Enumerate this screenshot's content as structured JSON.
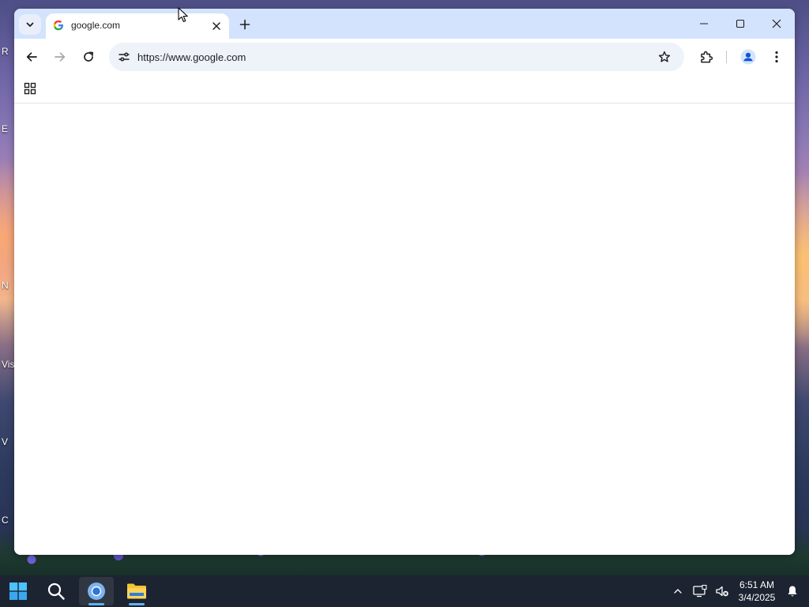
{
  "desktop": {
    "icon_labels": [
      "R",
      "E",
      "N",
      "Vis",
      "V",
      "C"
    ]
  },
  "browser": {
    "tab": {
      "title": "google.com",
      "favicon": "google-g-icon"
    },
    "address_bar": {
      "url": "https://www.google.com"
    },
    "icons": {
      "tab_search": "chevron-down-icon",
      "tab_close": "close-icon",
      "new_tab": "plus-icon",
      "minimize": "minimize-icon",
      "maximize": "maximize-icon",
      "close": "close-icon",
      "back": "arrow-left-icon",
      "forward": "arrow-right-icon",
      "reload": "reload-icon",
      "site_info": "tune-icon",
      "bookmark": "star-icon",
      "extensions": "puzzle-icon",
      "profile": "person-icon",
      "menu": "kebab-menu-icon",
      "apps": "apps-grid-icon"
    },
    "colors": {
      "tabstrip": "#d3e3fd",
      "omnibox": "#eef2f9",
      "profile": "#0b57d0"
    }
  },
  "taskbar": {
    "apps": [
      "start-icon",
      "search-icon",
      "chrome-icon",
      "file-explorer-icon"
    ],
    "clock": {
      "time": "6:51 AM",
      "date": "3/4/2025"
    },
    "tray": [
      "chevron-up-icon",
      "display-icon",
      "speaker-muted-icon",
      "bell-icon"
    ]
  }
}
